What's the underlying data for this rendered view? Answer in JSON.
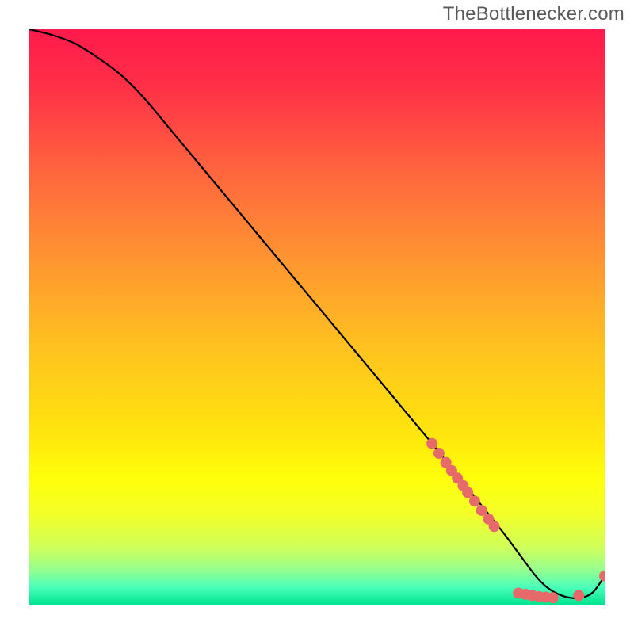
{
  "watermark": "TheBottlenecker.com",
  "chart_data": {
    "type": "line",
    "title": "",
    "xlabel": "",
    "ylabel": "",
    "xlim": [
      0,
      100
    ],
    "ylim": [
      0,
      100
    ],
    "grid": false,
    "legend": false,
    "background_gradient_stops": [
      {
        "offset": 0.0,
        "color": "#ff1a4b"
      },
      {
        "offset": 0.1,
        "color": "#ff3047"
      },
      {
        "offset": 0.25,
        "color": "#ff663e"
      },
      {
        "offset": 0.4,
        "color": "#ff9531"
      },
      {
        "offset": 0.55,
        "color": "#ffc120"
      },
      {
        "offset": 0.7,
        "color": "#ffe40e"
      },
      {
        "offset": 0.78,
        "color": "#ffff0a"
      },
      {
        "offset": 0.84,
        "color": "#f3ff26"
      },
      {
        "offset": 0.9,
        "color": "#d0ff5a"
      },
      {
        "offset": 0.94,
        "color": "#95ff90"
      },
      {
        "offset": 0.97,
        "color": "#4affba"
      },
      {
        "offset": 1.0,
        "color": "#00e48f"
      }
    ],
    "series": [
      {
        "name": "bottleneck-curve",
        "color": "#000000",
        "x": [
          0,
          4,
          8,
          12,
          16,
          20,
          25,
          30,
          35,
          40,
          45,
          50,
          55,
          60,
          65,
          70,
          74,
          78,
          82,
          85,
          88,
          90,
          92,
          94,
          96,
          98,
          100
        ],
        "y": [
          100,
          99,
          97.5,
          95,
          92,
          88,
          82,
          76,
          70,
          64,
          58,
          52,
          46,
          40,
          34,
          28,
          23,
          18,
          13,
          9,
          5,
          3,
          1.8,
          1.2,
          1.2,
          2.2,
          5
        ]
      }
    ],
    "markers": {
      "name": "highlight-dots",
      "color": "#e66a6a",
      "radius_px": 7,
      "points": [
        {
          "x": 70.0,
          "y": 28.0
        },
        {
          "x": 71.2,
          "y": 26.3
        },
        {
          "x": 72.4,
          "y": 24.7
        },
        {
          "x": 73.4,
          "y": 23.3
        },
        {
          "x": 74.4,
          "y": 22.0
        },
        {
          "x": 75.4,
          "y": 20.7
        },
        {
          "x": 76.2,
          "y": 19.5
        },
        {
          "x": 77.4,
          "y": 18.0
        },
        {
          "x": 78.6,
          "y": 16.4
        },
        {
          "x": 79.8,
          "y": 14.9
        },
        {
          "x": 80.8,
          "y": 13.6
        },
        {
          "x": 85.0,
          "y": 2.0
        },
        {
          "x": 86.2,
          "y": 1.8
        },
        {
          "x": 87.4,
          "y": 1.6
        },
        {
          "x": 88.6,
          "y": 1.4
        },
        {
          "x": 89.8,
          "y": 1.3
        },
        {
          "x": 91.0,
          "y": 1.2
        },
        {
          "x": 95.5,
          "y": 1.6
        },
        {
          "x": 100.0,
          "y": 5.0
        }
      ]
    }
  }
}
